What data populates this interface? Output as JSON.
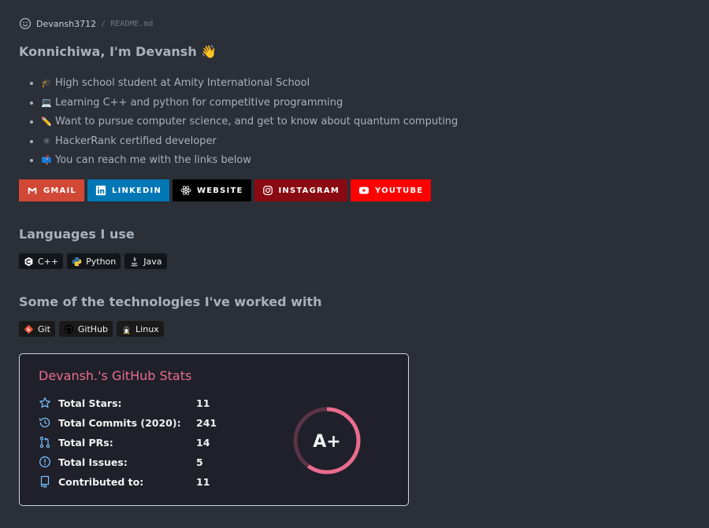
{
  "header": {
    "owner": "Devansh3712",
    "separator": "/",
    "file": "README.md"
  },
  "title": "Konnichiwa, I'm Devansh 👋",
  "intro": [
    {
      "emoji": "🎓",
      "text": "High school student at Amity International School"
    },
    {
      "emoji": "💻",
      "text": "Learning C++ and python for competitive programming"
    },
    {
      "emoji": "✏️",
      "text": "Want to pursue computer science, and get to know about quantum computing"
    },
    {
      "emoji": "⚛",
      "text": "HackerRank certified developer"
    },
    {
      "emoji": "📫",
      "text": "You can reach me with the links below"
    }
  ],
  "socials": [
    {
      "label": "GMAIL",
      "color": "#d14836",
      "icon": "gmail-icon"
    },
    {
      "label": "LINKEDIN",
      "color": "#0077b5",
      "icon": "linkedin-icon"
    },
    {
      "label": "WEBSITE",
      "color": "#000000",
      "icon": "react-icon"
    },
    {
      "label": "INSTAGRAM",
      "color": "#8a0a12",
      "icon": "instagram-icon"
    },
    {
      "label": "YOUTUBE",
      "color": "#ff0000",
      "icon": "youtube-icon"
    }
  ],
  "languages": {
    "heading": "Languages I use",
    "items": [
      {
        "label": "C++",
        "icon": "cpp-icon"
      },
      {
        "label": "Python",
        "icon": "python-icon"
      },
      {
        "label": "Java",
        "icon": "java-icon"
      }
    ]
  },
  "technologies": {
    "heading": "Some of the technologies I've worked with",
    "items": [
      {
        "label": "Git",
        "icon": "git-icon"
      },
      {
        "label": "GitHub",
        "icon": "github-icon"
      },
      {
        "label": "Linux",
        "icon": "linux-icon"
      }
    ]
  },
  "stats": {
    "title": "Devansh.'s GitHub Stats",
    "rows": [
      {
        "label": "Total Stars:",
        "value": "11",
        "icon": "star-icon"
      },
      {
        "label": "Total Commits (2020):",
        "value": "241",
        "icon": "history-icon"
      },
      {
        "label": "Total PRs:",
        "value": "14",
        "icon": "pull-request-icon"
      },
      {
        "label": "Total Issues:",
        "value": "5",
        "icon": "issue-icon"
      },
      {
        "label": "Contributed to:",
        "value": "11",
        "icon": "repo-icon"
      }
    ],
    "rank": "A+",
    "rank_progress": 0.6,
    "accent": "#e96c8f",
    "icon_color": "#79c0ff"
  }
}
